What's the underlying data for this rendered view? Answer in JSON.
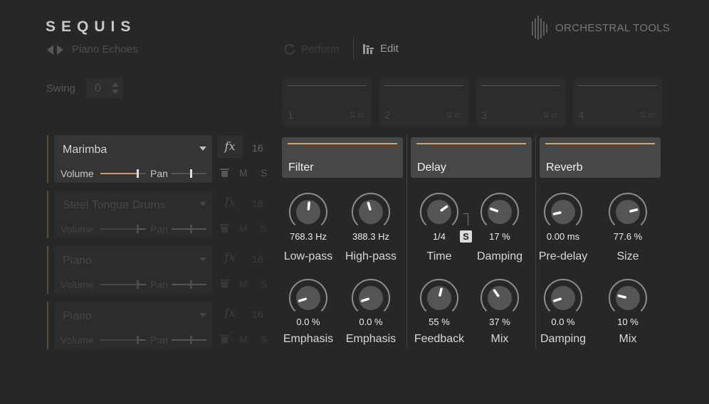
{
  "app": {
    "logo": "SEQUIS",
    "brand": "ORCHESTRAL TOOLS",
    "preset": "Piano Echoes"
  },
  "modes": {
    "perform": "Perform",
    "edit": "Edit",
    "active": "Edit"
  },
  "swing": {
    "label": "Swing",
    "value": "0"
  },
  "slots": [
    {
      "num": "1"
    },
    {
      "num": "2"
    },
    {
      "num": "3"
    },
    {
      "num": "4"
    }
  ],
  "layers": [
    {
      "name": "Marimba",
      "volume_label": "Volume",
      "pan_label": "Pan",
      "volume": 0.82,
      "pan": 0.55,
      "fx": "fx",
      "channel": "16",
      "mute": "M",
      "solo": "S",
      "active": true
    },
    {
      "name": "Steel Tongue Drums",
      "volume_label": "Volume",
      "pan_label": "Pan",
      "volume": 0.82,
      "pan": 0.55,
      "fx": "fx",
      "channel": "16",
      "mute": "M",
      "solo": "S",
      "active": false
    },
    {
      "name": "Piano",
      "volume_label": "Volume",
      "pan_label": "Pan",
      "volume": 0.82,
      "pan": 0.55,
      "fx": "fx",
      "channel": "16",
      "mute": "M",
      "solo": "S",
      "active": false
    },
    {
      "name": "Piano",
      "volume_label": "Volume",
      "pan_label": "Pan",
      "volume": 0.82,
      "pan": 0.55,
      "fx": "fx",
      "channel": "16",
      "mute": "M",
      "solo": "S",
      "active": false
    }
  ],
  "effects": {
    "filter": {
      "title": "Filter",
      "knobs": [
        {
          "label": "Low-pass",
          "value": "768.3 Hz",
          "level": 0.52
        },
        {
          "label": "High-pass",
          "value": "388.3 Hz",
          "level": 0.44
        },
        {
          "label": "Emphasis",
          "value": "0.0 %",
          "level": 0.1
        },
        {
          "label": "Emphasis",
          "value": "0.0 %",
          "level": 0.1
        }
      ]
    },
    "delay": {
      "title": "Delay",
      "sync": "S",
      "knobs": [
        {
          "label": "Time",
          "value": "1/4",
          "level": 0.7
        },
        {
          "label": "Damping",
          "value": "17 %",
          "level": 0.24
        },
        {
          "label": "Feedback",
          "value": "55 %",
          "level": 0.55
        },
        {
          "label": "Mix",
          "value": "37 %",
          "level": 0.37
        }
      ]
    },
    "reverb": {
      "title": "Reverb",
      "knobs": [
        {
          "label": "Pre-delay",
          "value": "0.00 ms",
          "level": 0.12
        },
        {
          "label": "Size",
          "value": "77.6 %",
          "level": 0.78
        },
        {
          "label": "Damping",
          "value": "0.0 %",
          "level": 0.1
        },
        {
          "label": "Mix",
          "value": "10 %",
          "level": 0.22
        }
      ]
    }
  },
  "colors": {
    "accent": "#d9a06a",
    "background": "#272727"
  }
}
